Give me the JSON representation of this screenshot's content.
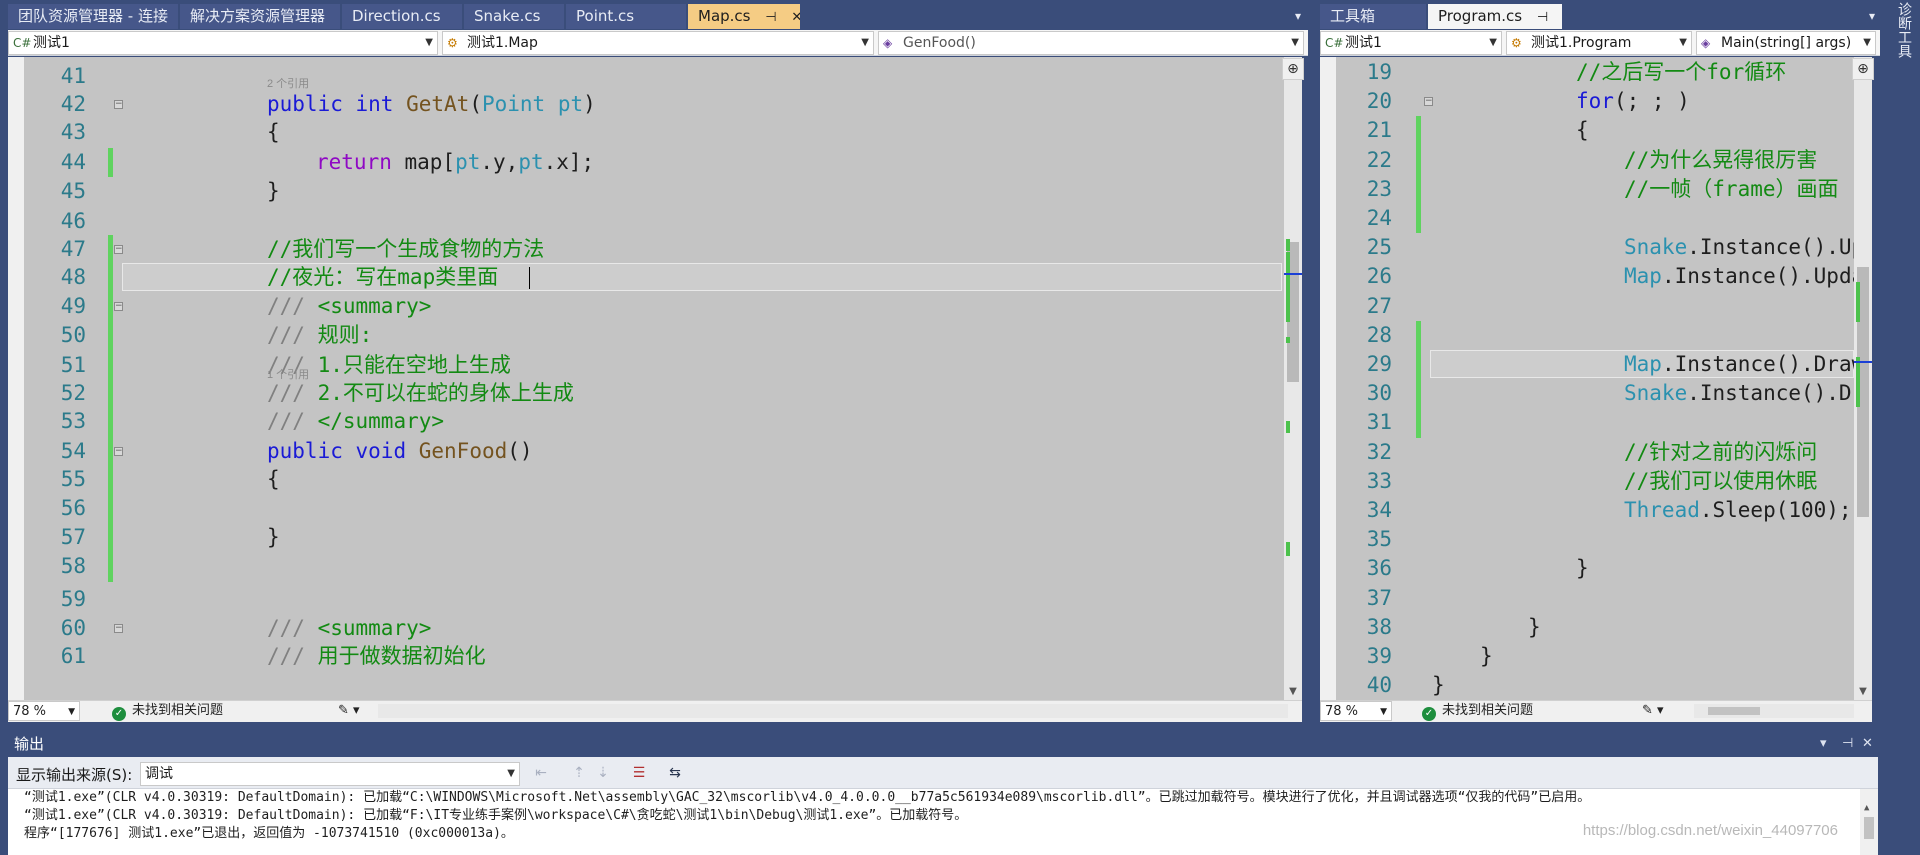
{
  "left_tabs": [
    {
      "label": "团队资源管理器 - 连接",
      "active": false
    },
    {
      "label": "解决方案资源管理器",
      "active": false
    },
    {
      "label": "Direction.cs",
      "active": false
    },
    {
      "label": "Snake.cs",
      "active": false
    },
    {
      "label": "Point.cs",
      "active": false
    },
    {
      "label": "Map.cs",
      "active": true,
      "pin_icon": "pin-icon",
      "close_icon": "close-icon"
    }
  ],
  "right_tabs": [
    {
      "label": "工具箱",
      "active": false
    },
    {
      "label": "Program.cs",
      "active": true,
      "pin_icon": "pin-icon",
      "close_icon": "close-icon"
    }
  ],
  "left_nav": {
    "project": "测试1",
    "class": "测试1.Map",
    "member": "GenFood()"
  },
  "right_nav": {
    "project": "测试1",
    "class": "测试1.Program",
    "member": "Main(string[] args)"
  },
  "side_tool": "诊断工具",
  "left_code": [
    {
      "n": "41",
      "t": ""
    },
    {
      "n": "42",
      "ref": "2 个引用",
      "t": "public int GetAt(Point pt)"
    },
    {
      "n": "43",
      "t": "{"
    },
    {
      "n": "44",
      "t": "return map[pt.y,pt.x];"
    },
    {
      "n": "45",
      "t": "}"
    },
    {
      "n": "46",
      "t": ""
    },
    {
      "n": "47",
      "t": "//我们写一个生成食物的方法"
    },
    {
      "n": "48",
      "t": "//夜光：写在map类里面"
    },
    {
      "n": "49",
      "t": "/// <summary>"
    },
    {
      "n": "50",
      "t": "/// 规则:"
    },
    {
      "n": "51",
      "t": "/// 1.只能在空地上生成"
    },
    {
      "n": "52",
      "t": "/// 2.不可以在蛇的身体上生成"
    },
    {
      "n": "53",
      "t": "/// </summary>"
    },
    {
      "n": "54",
      "ref": "1 个引用",
      "t": "public void GenFood()"
    },
    {
      "n": "55",
      "t": "{"
    },
    {
      "n": "56",
      "t": ""
    },
    {
      "n": "57",
      "t": "}"
    },
    {
      "n": "58",
      "t": ""
    },
    {
      "n": "59",
      "t": ""
    },
    {
      "n": "60",
      "t": "/// <summary>"
    },
    {
      "n": "61",
      "t": "/// 用于做数据初始化"
    }
  ],
  "right_code": [
    {
      "n": "19",
      "t": "//之后写一个for循环"
    },
    {
      "n": "20",
      "t": "for(; ; )"
    },
    {
      "n": "21",
      "t": "{"
    },
    {
      "n": "22",
      "t": "//为什么晃得很厉害"
    },
    {
      "n": "23",
      "t": "//一帧（frame）画面"
    },
    {
      "n": "24",
      "t": ""
    },
    {
      "n": "25",
      "t": "Snake.Instance().Up"
    },
    {
      "n": "26",
      "t": "Map.Instance().Upda"
    },
    {
      "n": "27",
      "t": ""
    },
    {
      "n": "28",
      "t": ""
    },
    {
      "n": "29",
      "t": "Map.Instance().Draw"
    },
    {
      "n": "30",
      "t": "Snake.Instance().Dr"
    },
    {
      "n": "31",
      "t": ""
    },
    {
      "n": "32",
      "t": "//针对之前的闪烁问"
    },
    {
      "n": "33",
      "t": "//我们可以使用休眠"
    },
    {
      "n": "34",
      "t": "Thread.Sleep(100);"
    },
    {
      "n": "35",
      "t": ""
    },
    {
      "n": "36",
      "t": "}"
    },
    {
      "n": "37",
      "t": ""
    },
    {
      "n": "38",
      "t": "}"
    },
    {
      "n": "39",
      "t": "}"
    },
    {
      "n": "40",
      "t": "}"
    }
  ],
  "left_status": {
    "zoom": "78 %",
    "issues": "未找到相关问题"
  },
  "right_status": {
    "zoom": "78 %",
    "issues": "未找到相关问题"
  },
  "output": {
    "title": "输出",
    "source_label": "显示输出来源(S):",
    "source_value": "调试",
    "lines": [
      "“测试1.exe”(CLR v4.0.30319: DefaultDomain): 已加载“C:\\WINDOWS\\Microsoft.Net\\assembly\\GAC_32\\mscorlib\\v4.0_4.0.0.0__b77a5c561934e089\\mscorlib.dll”。已跳过加载符号。模块进行了优化，并且调试器选项“仅我的代码”已启用。",
      "“测试1.exe”(CLR v4.0.30319: DefaultDomain): 已加载“F:\\IT专业练手案例\\workspace\\C#\\贪吃蛇\\测试1\\bin\\Debug\\测试1.exe”。已加载符号。",
      "程序“[177676] 测试1.exe”已退出，返回值为 -1073741510 (0xc000013a)。"
    ]
  },
  "watermark": "https://blog.csdn.net/weixin_44097706",
  "colors": {
    "frame": "#3a4d7a",
    "active_tab": "#f5cc84",
    "editor_bg": "#c4c4c4",
    "change_bar": "#5fd35f"
  }
}
